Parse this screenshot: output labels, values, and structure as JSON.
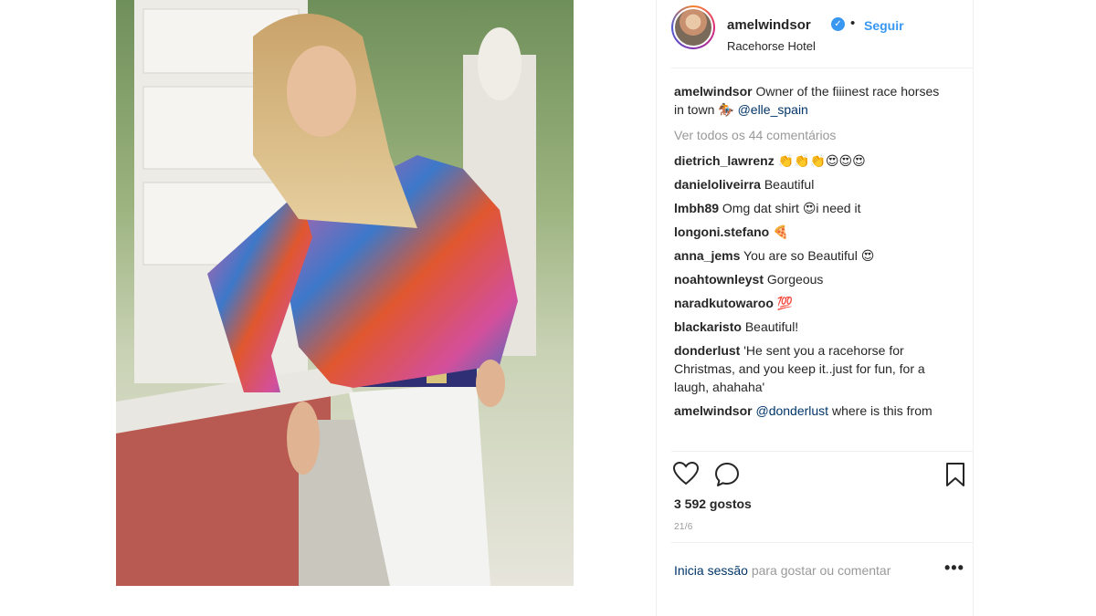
{
  "post": {
    "image_alt": "Photo: woman in patterned pink and blue shirt and white jeans leaning on a stone wall",
    "header": {
      "username": "amelwindsor",
      "dot": "•",
      "follow_label": "Seguir",
      "location": "Racehorse Hotel"
    },
    "comments": {
      "caption": {
        "user": "amelwindsor",
        "text": "Owner of the fiiinest race horses in town 🏇 ",
        "mention": "@elle_spain"
      },
      "view_all": "Ver todos os 44 comentários",
      "list": [
        {
          "user": "dietrich_lawrenz",
          "text": "👏👏👏😍😍😍"
        },
        {
          "user": "danieloliveirra",
          "text": "Beautiful"
        },
        {
          "user": "lmbh89",
          "text": "Omg dat shirt 😍i need it"
        },
        {
          "user": "longoni.stefano",
          "text": "🍕"
        },
        {
          "user": "anna_jems",
          "text": "You are so Beautiful 😍"
        },
        {
          "user": "noahtownleyst",
          "text": "Gorgeous"
        },
        {
          "user": "naradkutowaroo",
          "text": "💯"
        },
        {
          "user": "blackaristo",
          "text": "Beautiful!"
        },
        {
          "user": "donderlust",
          "text": "'He sent you a racehorse for Christmas, and you keep it..just for fun, for a laugh, ahahaha'"
        }
      ],
      "reply": {
        "user": "amelwindsor",
        "mention": "@donderlust",
        "text": " where is this from"
      }
    },
    "likes": "3 592 gostos",
    "date": "21/6",
    "login": {
      "link": "Inicia sessão",
      "text": " para gostar ou comentar"
    },
    "more_label": "•••"
  },
  "icons": {
    "like": "heart-icon",
    "comment": "comment-icon",
    "save": "bookmark-icon",
    "verified": "verified-badge-icon",
    "verified_glyph": "✓"
  },
  "colors": {
    "link_blue": "#3897f0",
    "mention_blue": "#003569",
    "muted": "#999999",
    "text": "#262626"
  }
}
